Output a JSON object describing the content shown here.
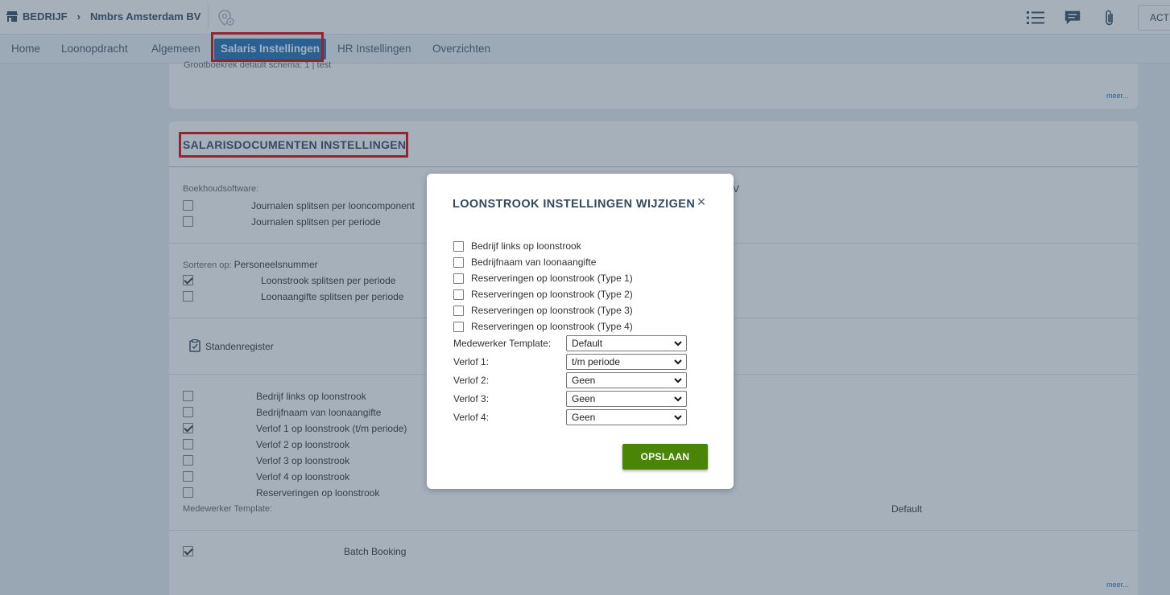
{
  "header": {
    "crumb_root": "BEDRIJF",
    "crumb_company": "Nmbrs Amsterdam BV",
    "act_label": "ACT"
  },
  "nav": {
    "tabs": [
      "Home",
      "Loonopdracht",
      "Algemeen",
      "Salaris Instellingen",
      "HR Instellingen",
      "Overzichten"
    ],
    "active": "Salaris Instellingen"
  },
  "card1": {
    "cut_text": "Grootboekrek default schema:          1 | test",
    "meer": "meer..."
  },
  "card2": {
    "title": "SALARISDOCUMENTEN INSTELLINGEN",
    "boekhoud_label": "Boekhoudsoftware:",
    "boekhoud_value_tail": "SV",
    "journal_items": [
      {
        "label": "Journalen splitsen per looncomponent",
        "checked": false
      },
      {
        "label": "Journalen splitsen per periode",
        "checked": false
      }
    ],
    "sorteren_label": "Sorteren op:",
    "sorteren_value": "Personeelsnummer",
    "sort_items": [
      {
        "label": "Loonstrook splitsen per periode",
        "checked": true
      },
      {
        "label": "Loonaangifte splitsen per periode",
        "checked": false
      }
    ],
    "standenregister": "Standenregister",
    "strook_items": [
      {
        "label": "Bedrijf links op loonstrook",
        "checked": false
      },
      {
        "label": "Bedrijfnaam van loonaangifte",
        "checked": false
      },
      {
        "label": "Verlof 1 op loonstrook (t/m periode)",
        "checked": true
      },
      {
        "label": "Verlof 2 op loonstrook",
        "checked": false
      },
      {
        "label": "Verlof 3 op loonstrook",
        "checked": false
      },
      {
        "label": "Verlof 4 op loonstrook",
        "checked": false
      },
      {
        "label": "Reserveringen op loonstrook",
        "checked": false
      }
    ],
    "medewerker_label": "Medewerker Template:",
    "medewerker_value": "Default",
    "batch_label": "Batch Booking",
    "batch_checked": true,
    "meer": "meer..."
  },
  "modal": {
    "title": "LOONSTROOK INSTELLINGEN WIJZIGEN",
    "close": "×",
    "checkboxes": [
      {
        "label": "Bedrijf links op loonstrook",
        "checked": false
      },
      {
        "label": "Bedrijfnaam van loonaangifte",
        "checked": false
      },
      {
        "label": "Reserveringen op loonstrook (Type 1)",
        "checked": false
      },
      {
        "label": "Reserveringen op loonstrook (Type 2)",
        "checked": false
      },
      {
        "label": "Reserveringen op loonstrook (Type 3)",
        "checked": false
      },
      {
        "label": "Reserveringen op loonstrook (Type 4)",
        "checked": false
      }
    ],
    "fields": [
      {
        "label": "Medewerker Template:",
        "value": "Default"
      },
      {
        "label": "Verlof 1:",
        "value": "t/m periode"
      },
      {
        "label": "Verlof 2:",
        "value": "Geen"
      },
      {
        "label": "Verlof 3:",
        "value": "Geen"
      },
      {
        "label": "Verlof 4:",
        "value": "Geen"
      }
    ],
    "save_label": "OPSLAAN"
  },
  "colors": {
    "accent": "#1c6fb5",
    "save": "#4a8506",
    "highlight": "#e00000"
  }
}
